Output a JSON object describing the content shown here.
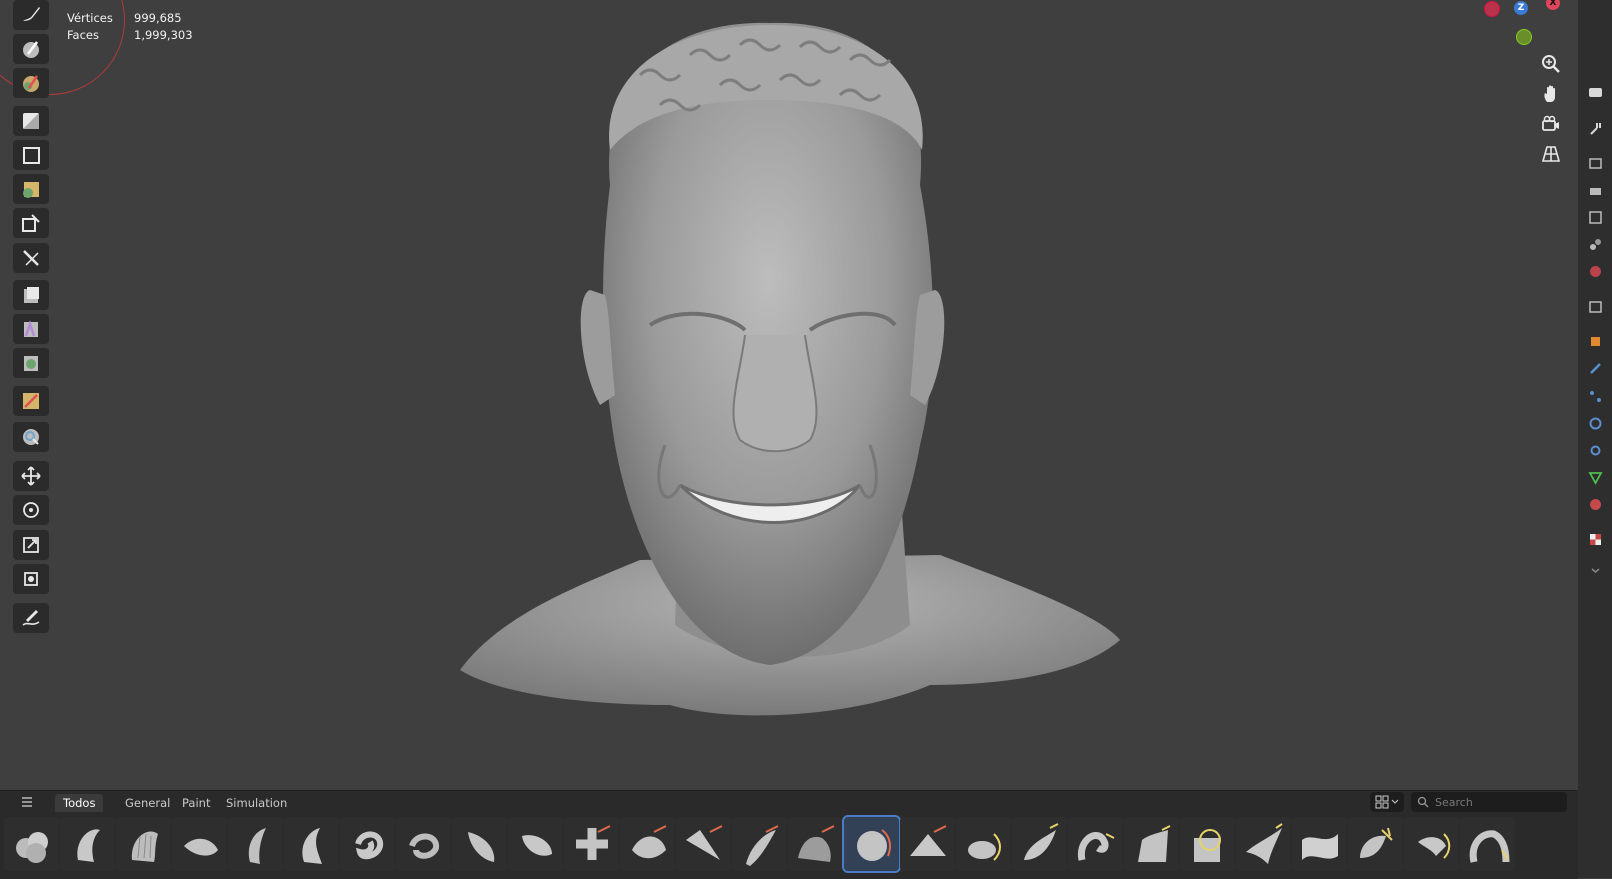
{
  "stats": {
    "vertices_label": "Vértices",
    "vertices_value": "999,685",
    "faces_label": "Faces",
    "faces_value": "1,999,303"
  },
  "gizmo": {
    "z_label": "Z",
    "x_label": "X"
  },
  "tools": [
    "draw-brush-tool-icon",
    "mask-brush-tool-icon",
    "face-set-paint-tool-icon",
    "box-mask-tool-icon",
    "box-hide-tool-icon",
    "box-face-set-tool-icon",
    "box-trim-tool-icon",
    "line-project-tool-icon",
    "mesh-filter-tool-icon",
    "cloth-filter-tool-icon",
    "color-filter-tool-icon",
    "edit-face-set-tool-icon",
    "mask-by-color-tool-icon",
    "move-tool-icon",
    "rotate-tool-icon",
    "scale-tool-icon",
    "transform-tool-icon",
    "annotate-tool-icon"
  ],
  "viewport_buttons": [
    "zoom-icon",
    "hand-pan-icon",
    "camera-view-icon",
    "perspective-grid-icon"
  ],
  "asset_shelf": {
    "tabs": [
      {
        "label": "Todos",
        "active": true
      },
      {
        "label": "General",
        "active": false
      },
      {
        "label": "Paint",
        "active": false
      },
      {
        "label": "Simulation",
        "active": false
      }
    ],
    "search_placeholder": "Search",
    "active_brush_index": 15,
    "brushes": [
      "blob-brush",
      "clay-brush",
      "clay-strips-brush",
      "clay-thumb-brush",
      "crease-brush",
      "crease-sharp-brush",
      "draw-brush",
      "draw-sharp-brush",
      "fill-brush",
      "flatten-brush",
      "pinch-brush",
      "layer-brush",
      "plane-brush",
      "scrape-brush",
      "multiplane-scrape-brush",
      "smooth-brush",
      "blur-brush",
      "elastic-grab-brush",
      "grab-brush",
      "snake-hook-brush",
      "nudge-brush",
      "pose-brush",
      "rotate-brush",
      "thumb-brush",
      "boundary-brush",
      "relax-brush",
      "twist-brush"
    ]
  },
  "colors": {
    "accent": "#4b7bc6",
    "viewport_bg": "#3f3f3f",
    "panel_bg": "#2a2a2a"
  }
}
